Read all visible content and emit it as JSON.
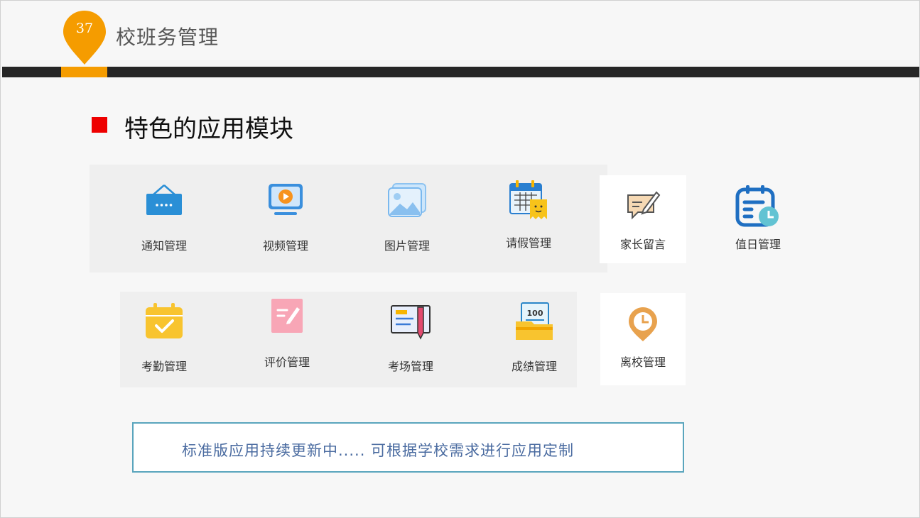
{
  "header": {
    "page_number": "37",
    "title": "校班务管理",
    "accent_color": "#f59c00",
    "bar_color": "#262626"
  },
  "section": {
    "title": "特色的应用模块",
    "bullet_color": "#ee0000"
  },
  "modules": [
    {
      "label": "通知管理",
      "icon": "notice-board-icon"
    },
    {
      "label": "视频管理",
      "icon": "video-monitor-icon"
    },
    {
      "label": "图片管理",
      "icon": "image-gallery-icon"
    },
    {
      "label": "请假管理",
      "icon": "leave-calendar-icon"
    },
    {
      "label": "家长留言",
      "icon": "message-pen-icon"
    },
    {
      "label": "值日管理",
      "icon": "duty-calendar-clock-icon"
    },
    {
      "label": "考勤管理",
      "icon": "attendance-check-icon"
    },
    {
      "label": "评价管理",
      "icon": "evaluation-note-icon"
    },
    {
      "label": "考场管理",
      "icon": "exam-card-pen-icon"
    },
    {
      "label": "成绩管理",
      "icon": "score-folder-icon"
    },
    {
      "label": "离校管理",
      "icon": "leave-school-clock-pin-icon"
    }
  ],
  "notice": {
    "text": "标准版应用持续更新中.....   可根据学校需求进行应用定制"
  }
}
